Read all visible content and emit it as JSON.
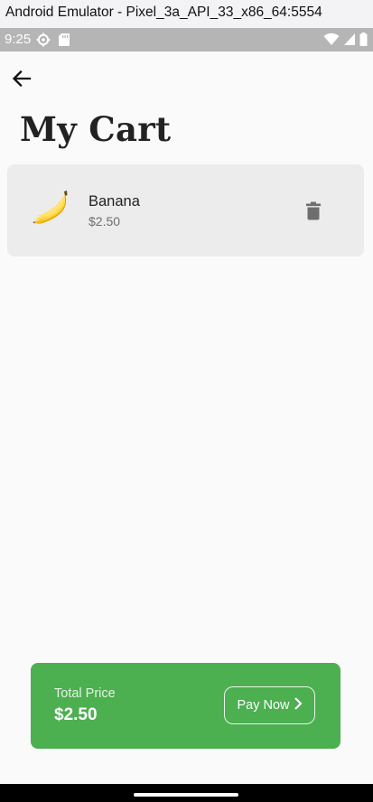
{
  "window": {
    "title": "Android Emulator - Pixel_3a_API_33_x86_64:5554"
  },
  "status_bar": {
    "time": "9:25",
    "left_icons": [
      "settings-icon",
      "sd-card-icon"
    ],
    "right_icons": [
      "wifi-icon",
      "signal-icon",
      "battery-icon"
    ]
  },
  "app": {
    "back_icon": "arrow-back-icon",
    "title": "My Cart",
    "cart_items": [
      {
        "name": "Banana",
        "price": "$2.50",
        "image": "banana-icon",
        "action_icon": "delete-icon"
      }
    ],
    "footer": {
      "total_label": "Total Price",
      "total_value": "$2.50",
      "pay_button_label": "Pay Now",
      "pay_button_icon": "chevron-right-icon"
    }
  },
  "colors": {
    "accent_green": "#4caf50",
    "background": "#fafafa",
    "item_card": "#ececec",
    "status_bar": "#b5b5b5"
  }
}
